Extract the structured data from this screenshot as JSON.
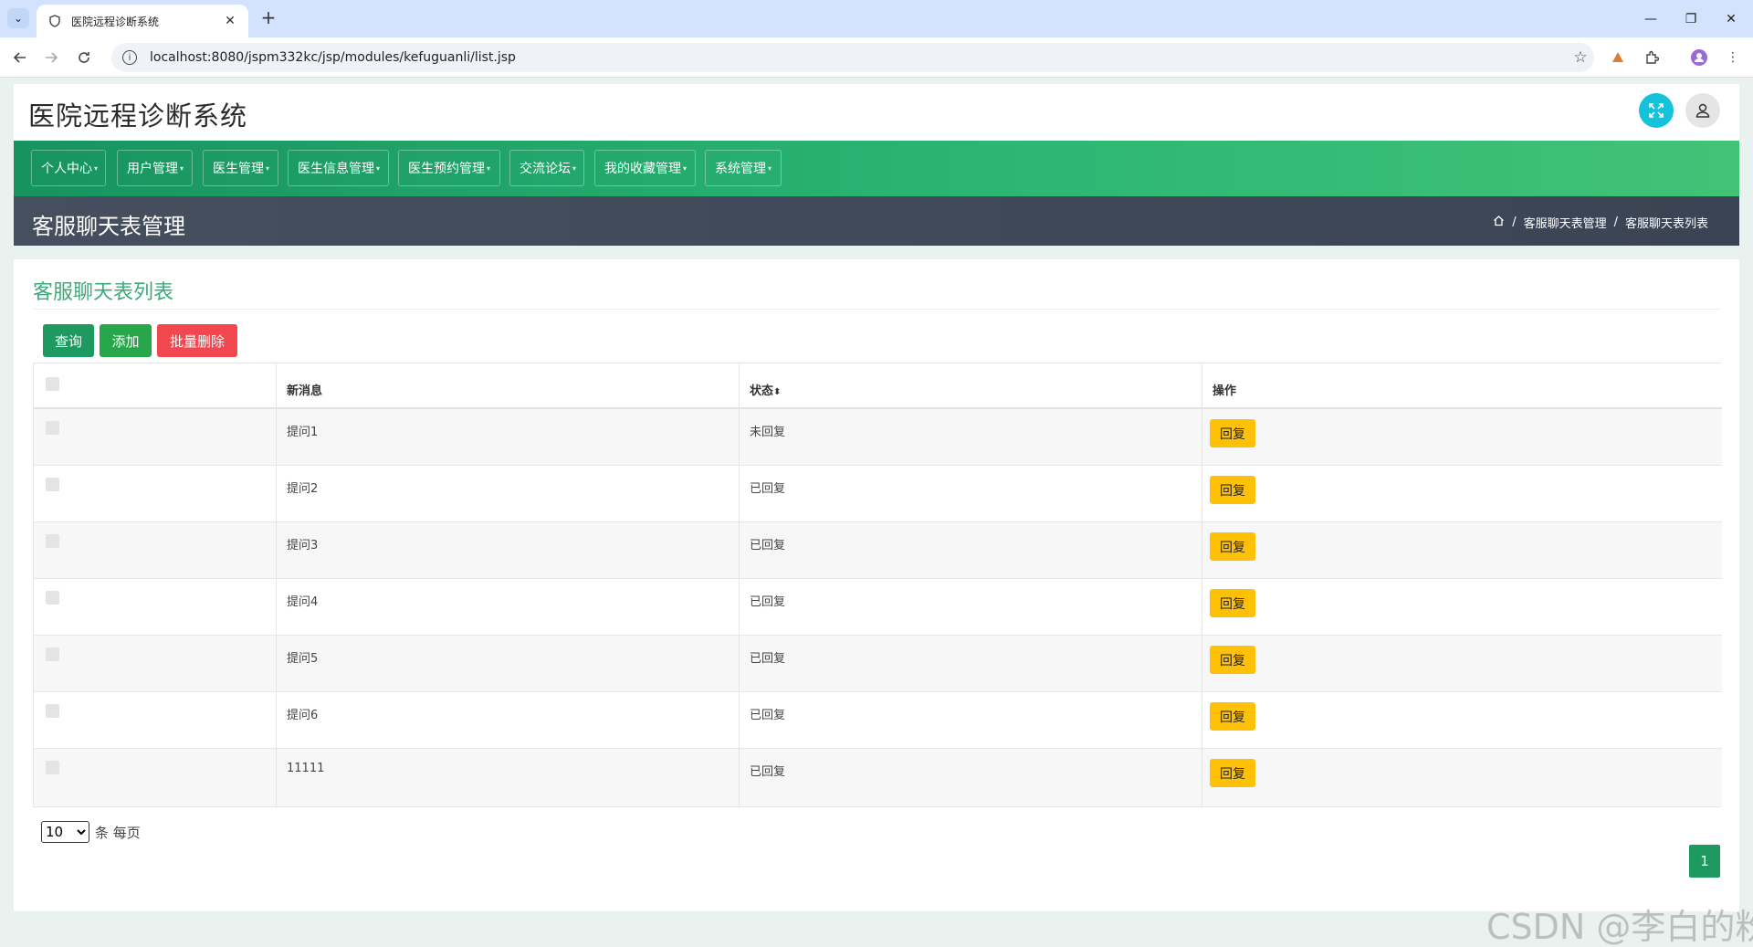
{
  "browser": {
    "tab_title": "医院远程诊断系统",
    "tab_close": "✕",
    "new_tab": "+",
    "url": "localhost:8080/jspm332kc/jsp/modules/kefuguanli/list.jsp",
    "window_controls": {
      "minimize": "—",
      "restore": "❐",
      "close": "✕"
    }
  },
  "header": {
    "brand": "医院远程诊断系统"
  },
  "nav": {
    "items": [
      {
        "label": "个人中心"
      },
      {
        "label": "用户管理"
      },
      {
        "label": "医生管理"
      },
      {
        "label": "医生信息管理"
      },
      {
        "label": "医生预约管理"
      },
      {
        "label": "交流论坛"
      },
      {
        "label": "我的收藏管理"
      },
      {
        "label": "系统管理"
      }
    ]
  },
  "title_bar": {
    "title": "客服聊天表管理",
    "breadcrumb": {
      "separator": "/",
      "items": [
        "客服聊天表管理",
        "客服聊天表列表"
      ]
    }
  },
  "card": {
    "title": "客服聊天表列表",
    "buttons": {
      "query": "查询",
      "add": "添加",
      "batch_delete": "批量删除"
    }
  },
  "table": {
    "headers": {
      "message": "新消息",
      "status": "状态",
      "action": "操作"
    },
    "sort_icon": "⬍",
    "action_label": "回复",
    "rows": [
      {
        "message": "提问1",
        "status": "未回复"
      },
      {
        "message": "提问2",
        "status": "已回复"
      },
      {
        "message": "提问3",
        "status": "已回复"
      },
      {
        "message": "提问4",
        "status": "已回复"
      },
      {
        "message": "提问5",
        "status": "已回复"
      },
      {
        "message": "提问6",
        "status": "已回复"
      },
      {
        "message": "11111",
        "status": "已回复"
      }
    ]
  },
  "pager": {
    "page_size": "10",
    "page_size_suffix": "条 每页",
    "current_page": "1"
  },
  "watermark": "CSDN @李白的粉",
  "colors": {
    "nav_green": "#2bb574",
    "primary": "#1e9a60",
    "add": "#27a64a",
    "danger": "#f2474f",
    "warning": "#ffc107",
    "title_bar": "#454f5e",
    "expand_button": "#15c2dc"
  },
  "icons": {
    "tab_dropdown": "chevron-down-icon",
    "favicon": "shield-icon",
    "back": "arrow-left-icon",
    "forward": "arrow-right-icon",
    "reload": "reload-icon",
    "info": "info-icon",
    "bookmark": "star-icon",
    "extension": "puzzle-icon",
    "profile": "profile-avatar-icon",
    "menu": "kebab-menu-icon",
    "fullscreen": "fullscreen-icon",
    "user": "user-icon",
    "home": "home-icon"
  }
}
